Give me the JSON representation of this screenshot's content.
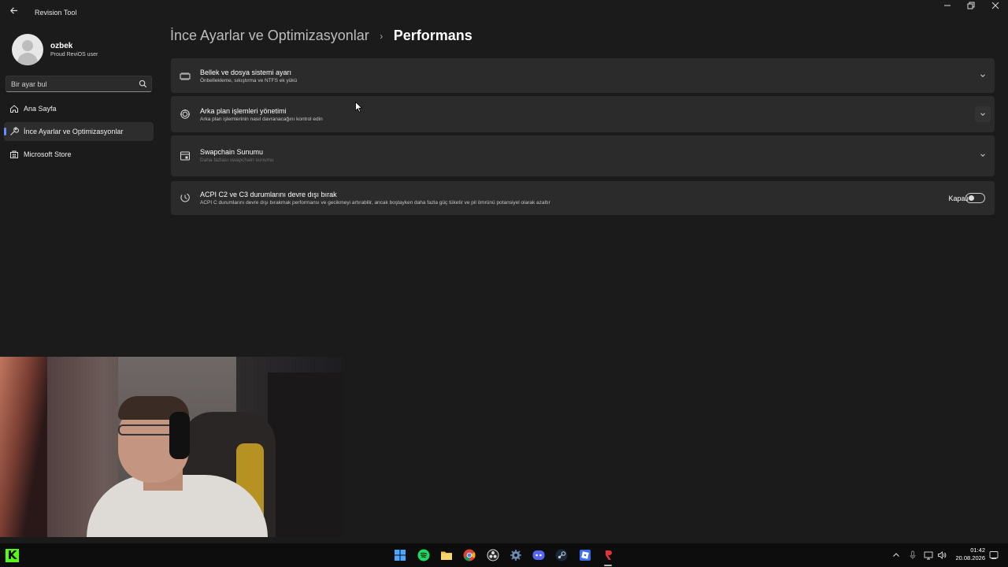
{
  "window": {
    "title": "Revision Tool",
    "back_icon": "arrow-left-icon",
    "controls": [
      "minimize-icon",
      "restore-icon",
      "close-icon"
    ]
  },
  "profile": {
    "name": "ozbek",
    "subtitle": "Proud ReviOS user"
  },
  "search": {
    "placeholder": "Bir ayar bul"
  },
  "nav": {
    "items": [
      {
        "label": "Ana Sayfa",
        "icon": "home-icon",
        "active": false
      },
      {
        "label": "İnce Ayarlar ve Optimizasyonlar",
        "icon": "wrench-icon",
        "active": true
      },
      {
        "label": "Microsoft Store",
        "icon": "store-icon",
        "active": false
      }
    ]
  },
  "header": {
    "parent": "İnce Ayarlar ve Optimizasyonlar",
    "separator": "›",
    "current": "Performans"
  },
  "settings": [
    {
      "title": "Bellek ve dosya sistemi ayarı",
      "description": "Önbellekleme, sıkıştırma ve NTFS ek yükü",
      "icon": "memory-icon",
      "control": "expand"
    },
    {
      "title": "Arka plan işlemleri yönetimi",
      "description": "Arka plan işlemlerinin nasıl davranacağını kontrol edin",
      "icon": "background-process-icon",
      "control": "expand"
    },
    {
      "title": "Swapchain Sunumu",
      "description": "Daha fazlası swapchain sunumu",
      "icon": "window-icon",
      "control": "expand"
    },
    {
      "title": "ACPI C2 ve C3 durumlarını devre dışı bırak",
      "description": "ACPI C durumlarını devre dışı bırakmak performansı ve gecikmeyi artırabilir, ancak boştayken daha fazla güç tüketir ve pil ömrünü potansiyel olarak azaltır",
      "icon": "power-state-icon",
      "control": "toggle",
      "toggle_label": "Kapalı",
      "toggle_on": false
    }
  ],
  "taskbar": {
    "apps": [
      "kick-icon",
      "windows-start-icon",
      "spotify-icon",
      "file-explorer-icon",
      "chrome-icon",
      "obs-icon",
      "settings-gear-icon",
      "discord-icon",
      "steam-icon",
      "roblox-icon",
      "revision-tool-icon"
    ],
    "tray": [
      "chevron-up-icon",
      "microphone-icon",
      "network-icon",
      "volume-icon",
      "notification-icon"
    ],
    "time": "01:42",
    "date": "20.08.2026"
  },
  "colors": {
    "background": "#1b1b1b",
    "card": "#2b2b2b",
    "accent": "#6b8cff",
    "taskbar": "#0d0d0d"
  }
}
